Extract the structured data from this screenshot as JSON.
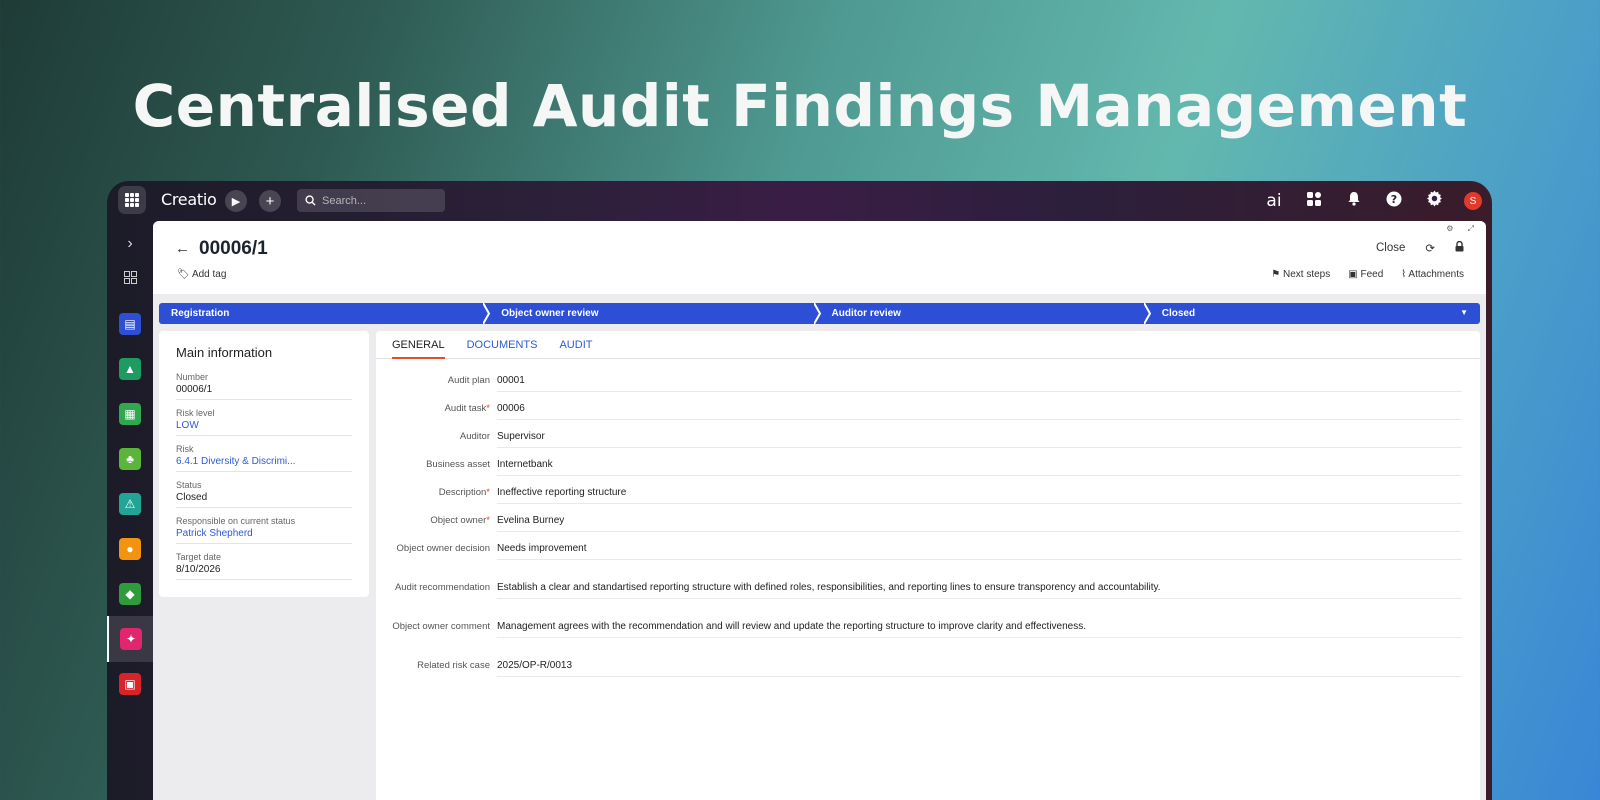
{
  "headline": "Centralised Audit Findings Management",
  "app": {
    "logo": "Creatio",
    "search_placeholder": "Search...",
    "avatar_initial": "S",
    "ai_label": "ai"
  },
  "record": {
    "title": "00006/1",
    "add_tag": "Add tag",
    "close_label": "Close",
    "next_steps": "Next steps",
    "feed": "Feed",
    "attachments": "Attachments"
  },
  "stages": [
    "Registration",
    "Object owner review",
    "Auditor review",
    "Closed"
  ],
  "main_info": {
    "title": "Main information",
    "fields": [
      {
        "label": "Number",
        "value": "00006/1"
      },
      {
        "label": "Risk level",
        "value": "LOW"
      },
      {
        "label": "Risk",
        "value": "6.4.1 Diversity & Discrimi..."
      },
      {
        "label": "Status",
        "value": "Closed"
      },
      {
        "label": "Responsible on current status",
        "value": "Patrick Shepherd"
      },
      {
        "label": "Target date",
        "value": "8/10/2026"
      }
    ]
  },
  "tabs": [
    "GENERAL",
    "DOCUMENTS",
    "AUDIT"
  ],
  "general": [
    {
      "label": "Audit plan",
      "value": "00001"
    },
    {
      "label": "Audit task",
      "value": "00006"
    },
    {
      "label": "Auditor",
      "value": "Supervisor"
    },
    {
      "label": "Business asset",
      "value": "Internetbank"
    },
    {
      "label": "Description",
      "value": "Ineffective reporting structure"
    },
    {
      "label": "Object owner",
      "value": "Evelina Burney"
    },
    {
      "label": "Object owner decision",
      "value": "Needs improvement"
    },
    {
      "label": "Audit recommendation",
      "value": "Establish a clear and standartised reporting structure with defined roles, responsibilities, and reporting lines to ensure transporency and accountability."
    },
    {
      "label": "Object owner comment",
      "value": "Management agrees with the recommendation and will review  and update the reporting structure to improve clarity and effectiveness."
    },
    {
      "label": "Related risk case",
      "value": "2025/OP-R/0013"
    }
  ],
  "colors": {
    "stage_bar": "#2c4fd6",
    "link": "#2a5bd7",
    "active_tab_underline": "#e34f2a"
  }
}
